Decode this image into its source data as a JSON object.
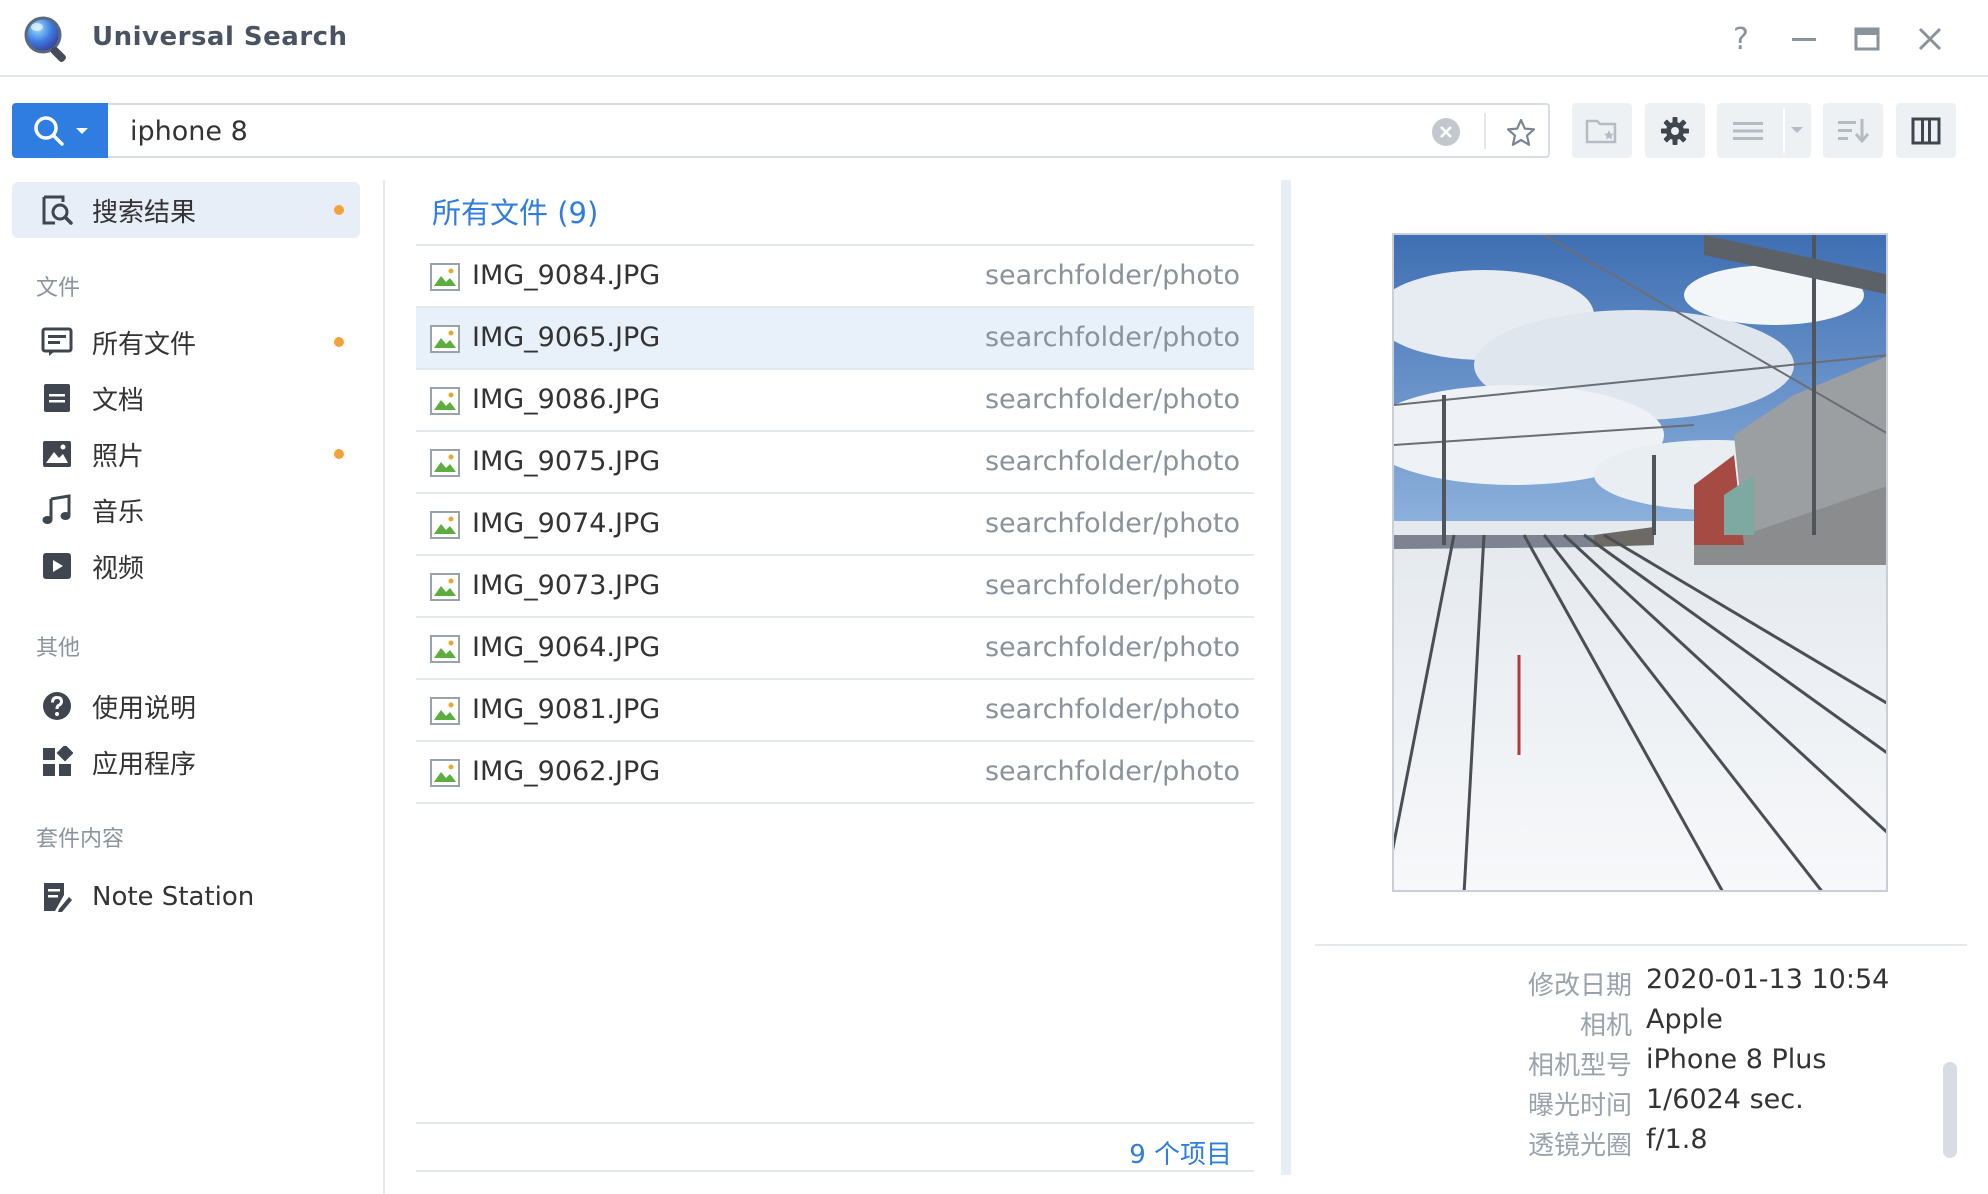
{
  "app": {
    "title": "Universal Search"
  },
  "window_controls": {
    "help": "?"
  },
  "search": {
    "query": "iphone 8",
    "placeholder": ""
  },
  "sidebar": {
    "results_label": "搜索结果",
    "section_files": "文件",
    "files": [
      {
        "label": "所有文件",
        "icon": "all-files-icon",
        "dot": true
      },
      {
        "label": "文档",
        "icon": "document-icon",
        "dot": false
      },
      {
        "label": "照片",
        "icon": "photo-icon",
        "dot": true
      },
      {
        "label": "音乐",
        "icon": "music-icon",
        "dot": false
      },
      {
        "label": "视频",
        "icon": "video-icon",
        "dot": false
      }
    ],
    "section_other": "其他",
    "other": [
      {
        "label": "使用说明",
        "icon": "help-icon"
      },
      {
        "label": "应用程序",
        "icon": "apps-icon"
      }
    ],
    "section_packages": "套件内容",
    "packages": [
      {
        "label": "Note Station",
        "icon": "note-station-icon"
      }
    ]
  },
  "results": {
    "title": "所有文件 (9)",
    "count_label": "9 个项目",
    "selected_index": 1,
    "rows": [
      {
        "name": "IMG_9084.JPG",
        "path": "searchfolder/photo"
      },
      {
        "name": "IMG_9065.JPG",
        "path": "searchfolder/photo"
      },
      {
        "name": "IMG_9086.JPG",
        "path": "searchfolder/photo"
      },
      {
        "name": "IMG_9075.JPG",
        "path": "searchfolder/photo"
      },
      {
        "name": "IMG_9074.JPG",
        "path": "searchfolder/photo"
      },
      {
        "name": "IMG_9073.JPG",
        "path": "searchfolder/photo"
      },
      {
        "name": "IMG_9064.JPG",
        "path": "searchfolder/photo"
      },
      {
        "name": "IMG_9081.JPG",
        "path": "searchfolder/photo"
      },
      {
        "name": "IMG_9062.JPG",
        "path": "searchfolder/photo"
      }
    ]
  },
  "preview": {
    "metadata": [
      {
        "label": "修改日期",
        "value": "2020-01-13 10:54"
      },
      {
        "label": "相机",
        "value": "Apple"
      },
      {
        "label": "相机型号",
        "value": "iPhone 8 Plus"
      },
      {
        "label": "曝光时间",
        "value": "1/6024 sec."
      },
      {
        "label": "透镜光圈",
        "value": "f/1.8"
      }
    ]
  },
  "colors": {
    "accent": "#2f7de1",
    "selected_row": "#e8f0fa",
    "badge_dot": "#f1a33a",
    "toolbar_button": "#eef1f4"
  }
}
